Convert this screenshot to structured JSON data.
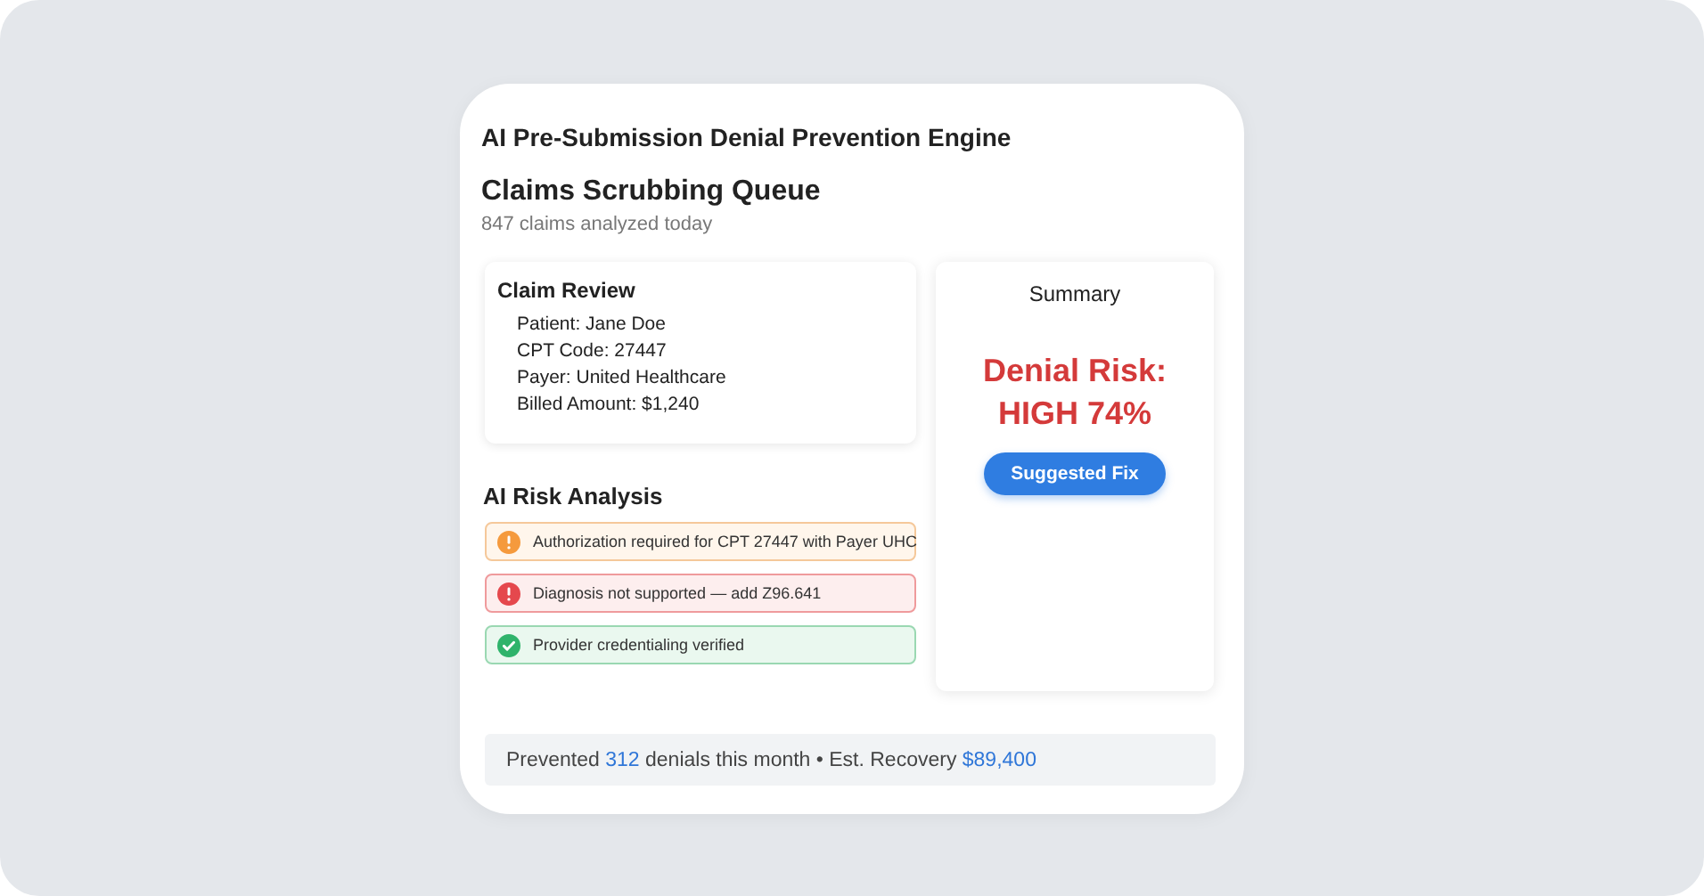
{
  "app_title": "AI Pre-Submission Denial Prevention Engine",
  "queue": {
    "title": "Claims Scrubbing Queue",
    "subtitle": "847 claims analyzed today"
  },
  "claim_review": {
    "title": "Claim Review",
    "fields": [
      "Patient: Jane Doe",
      "CPT Code: 27447",
      "Payer: United Healthcare",
      "Billed Amount: $1,240"
    ]
  },
  "risk_analysis": {
    "title": "AI Risk Analysis",
    "alerts": [
      {
        "kind": "warning",
        "text": "Authorization required for CPT 27447 with Payer UHC"
      },
      {
        "kind": "error",
        "text": "Diagnosis not supported — add Z96.641"
      },
      {
        "kind": "success",
        "text": "Provider credentialing verified"
      }
    ]
  },
  "summary": {
    "title": "Summary",
    "risk_label": "Denial Risk:",
    "risk_value": "HIGH 74%",
    "button": "Suggested Fix"
  },
  "footer": [
    {
      "text": "Prevented ",
      "highlight": false
    },
    {
      "text": "312",
      "highlight": true
    },
    {
      "text": " denials this month • Est. Recovery ",
      "highlight": false
    },
    {
      "text": "$89,400",
      "highlight": true
    }
  ]
}
